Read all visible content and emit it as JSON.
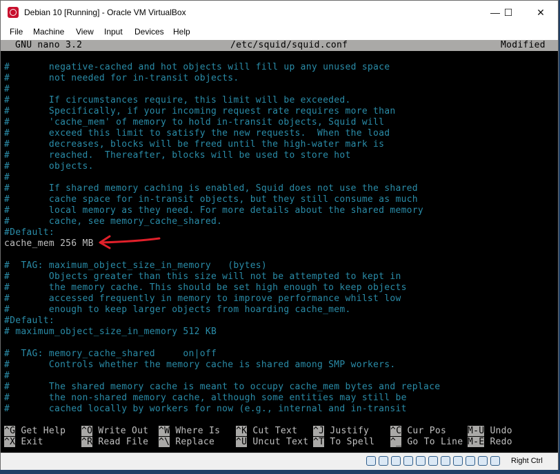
{
  "window": {
    "title": "Debian 10 [Running] - Oracle VM VirtualBox"
  },
  "window_controls": {
    "minimize": "—",
    "maximize": "☐",
    "close": "✕"
  },
  "menu": [
    "File",
    "Machine",
    "View",
    "Input",
    "Devices",
    "Help"
  ],
  "nano": {
    "version": "GNU nano 3.2",
    "filename": "/etc/squid/squid.conf",
    "status": "Modified"
  },
  "lines": [
    {
      "text": "#       negative-cached and hot objects will fill up any unused space",
      "style": "comment"
    },
    {
      "text": "#       not needed for in-transit objects.",
      "style": "comment"
    },
    {
      "text": "#",
      "style": "comment"
    },
    {
      "text": "#       If circumstances require, this limit will be exceeded.",
      "style": "comment"
    },
    {
      "text": "#       Specifically, if your incoming request rate requires more than",
      "style": "comment"
    },
    {
      "text": "#       'cache_mem' of memory to hold in-transit objects, Squid will",
      "style": "comment"
    },
    {
      "text": "#       exceed this limit to satisfy the new requests.  When the load",
      "style": "comment"
    },
    {
      "text": "#       decreases, blocks will be freed until the high-water mark is",
      "style": "comment"
    },
    {
      "text": "#       reached.  Thereafter, blocks will be used to store hot",
      "style": "comment"
    },
    {
      "text": "#       objects.",
      "style": "comment"
    },
    {
      "text": "#",
      "style": "comment"
    },
    {
      "text": "#       If shared memory caching is enabled, Squid does not use the shared",
      "style": "comment"
    },
    {
      "text": "#       cache space for in-transit objects, but they still consume as much",
      "style": "comment"
    },
    {
      "text": "#       local memory as they need. For more details about the shared memory",
      "style": "comment"
    },
    {
      "text": "#       cache, see memory_cache_shared.",
      "style": "comment"
    },
    {
      "text": "#Default:",
      "style": "comment"
    },
    {
      "text": "cache_mem 256 MB",
      "style": "plain"
    },
    {
      "text": "",
      "style": "plain"
    },
    {
      "text": "#  TAG: maximum_object_size_in_memory   (bytes)",
      "style": "comment"
    },
    {
      "text": "#       Objects greater than this size will not be attempted to kept in",
      "style": "comment"
    },
    {
      "text": "#       the memory cache. This should be set high enough to keep objects",
      "style": "comment"
    },
    {
      "text": "#       accessed frequently in memory to improve performance whilst low",
      "style": "comment"
    },
    {
      "text": "#       enough to keep larger objects from hoarding cache_mem.",
      "style": "comment"
    },
    {
      "text": "#Default:",
      "style": "comment"
    },
    {
      "text": "# maximum_object_size_in_memory 512 KB",
      "style": "comment"
    },
    {
      "text": "",
      "style": "plain"
    },
    {
      "text": "#  TAG: memory_cache_shared     on|off",
      "style": "comment"
    },
    {
      "text": "#       Controls whether the memory cache is shared among SMP workers.",
      "style": "comment"
    },
    {
      "text": "#",
      "style": "comment"
    },
    {
      "text": "#       The shared memory cache is meant to occupy cache_mem bytes and replace",
      "style": "comment"
    },
    {
      "text": "#       the non-shared memory cache, although some entities may still be",
      "style": "comment"
    },
    {
      "text": "#       cached locally by workers for now (e.g., internal and in-transit",
      "style": "comment"
    }
  ],
  "shortcuts": [
    [
      {
        "key": "^G",
        "label": "Get Help"
      },
      {
        "key": "^X",
        "label": "Exit"
      }
    ],
    [
      {
        "key": "^O",
        "label": "Write Out"
      },
      {
        "key": "^R",
        "label": "Read File"
      }
    ],
    [
      {
        "key": "^W",
        "label": "Where Is"
      },
      {
        "key": "^\\",
        "label": "Replace"
      }
    ],
    [
      {
        "key": "^K",
        "label": "Cut Text"
      },
      {
        "key": "^U",
        "label": "Uncut Text"
      }
    ],
    [
      {
        "key": "^J",
        "label": "Justify"
      },
      {
        "key": "^T",
        "label": "To Spell"
      }
    ],
    [
      {
        "key": "^C",
        "label": "Cur Pos"
      },
      {
        "key": "^_",
        "label": "Go To Line"
      }
    ],
    [
      {
        "key": "M-U",
        "label": "Undo"
      },
      {
        "key": "M-E",
        "label": "Redo"
      }
    ]
  ],
  "statusbar": {
    "icons": [
      "hard-disk-icon",
      "optical-drive-icon",
      "audio-icon",
      "network-icon",
      "usb-icon",
      "shared-folder-icon",
      "display-icon",
      "video-capture-icon",
      "cpu-icon",
      "mouse-integration-icon",
      "keyboard-capture-icon"
    ],
    "host_key": "Right Ctrl"
  },
  "colors": {
    "comment": "#2a8ca8",
    "plain": "#c0c0c0",
    "nano_bar": "#aaa9a7",
    "annotation": "#e0202a"
  }
}
